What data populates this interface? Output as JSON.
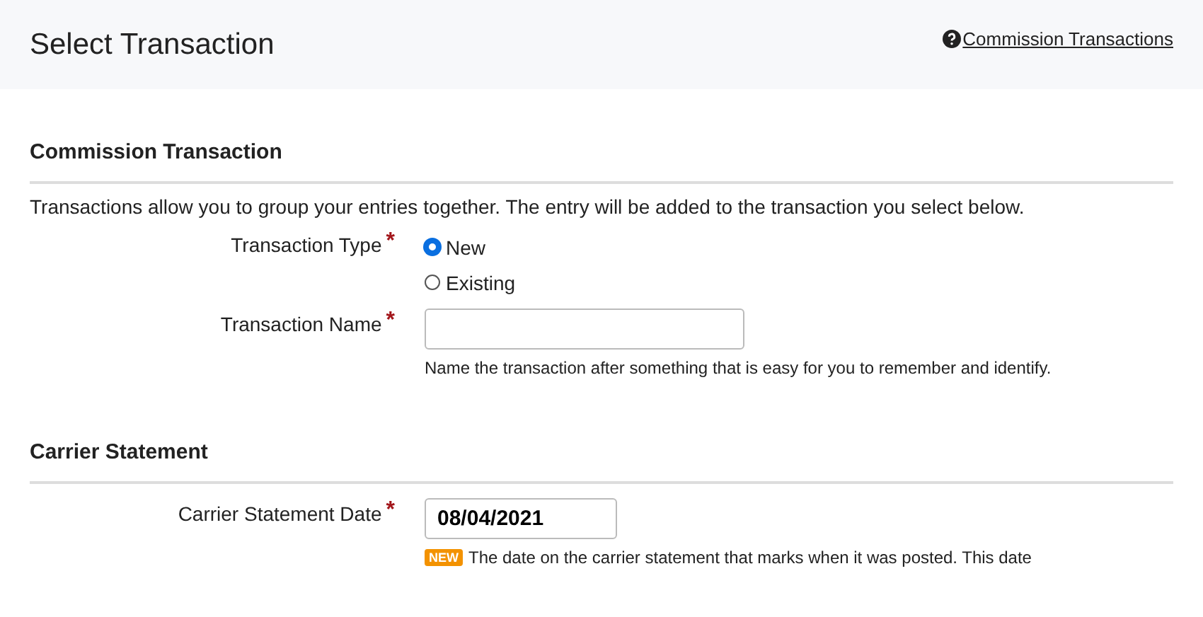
{
  "header": {
    "title": "Select Transaction",
    "help_link": "Commission Transactions"
  },
  "sections": [
    {
      "title": "Commission Transaction",
      "intro": "Transactions allow you to group your entries together. The entry will be added to the transaction you select below.",
      "fields": [
        {
          "kind": "radio",
          "label": "Transaction Type",
          "required_mark": "*",
          "options": [
            {
              "label": "New",
              "selected": true
            },
            {
              "label": "Existing",
              "selected": false
            }
          ]
        },
        {
          "kind": "text",
          "label": "Transaction Name",
          "required_mark": "*",
          "help": "Name the transaction after something that is easy for you to remember and identify."
        }
      ]
    },
    {
      "title": "Carrier Statement",
      "fields": [
        {
          "kind": "date",
          "label": "Carrier Statement Date",
          "required_mark": "*",
          "value": "08/04/2021",
          "badge": "NEW",
          "help": "The date on the carrier statement that marks when it was posted. This date"
        }
      ]
    }
  ]
}
